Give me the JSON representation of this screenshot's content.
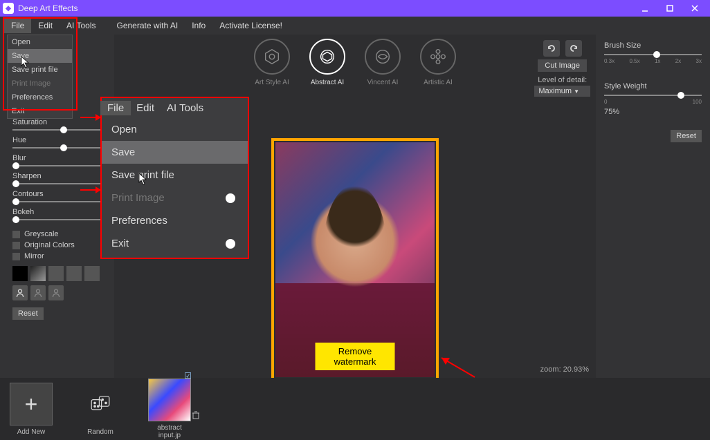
{
  "app": {
    "title": "Deep Art Effects"
  },
  "menu": {
    "file": "File",
    "edit": "Edit",
    "ai_tools": "AI Tools",
    "generate": "Generate with AI",
    "info": "Info",
    "activate": "Activate License!"
  },
  "file_menu": {
    "open": "Open",
    "save": "Save",
    "save_print": "Save print file",
    "print": "Print Image",
    "prefs": "Preferences",
    "exit": "Exit"
  },
  "sliders": {
    "saturation": "Saturation",
    "hue": "Hue",
    "blur": "Blur",
    "sharpen": "Sharpen",
    "contours": "Contours",
    "bokeh": "Bokeh"
  },
  "checks": {
    "grey": "Greyscale",
    "orig": "Original Colors",
    "mirror": "Mirror"
  },
  "reset": "Reset",
  "ai": {
    "art": "Art Style AI",
    "abstract": "Abstract AI",
    "vincent": "Vincent AI",
    "artistic": "Artistic AI"
  },
  "cut": {
    "button": "Cut Image",
    "lod_label": "Level of detail:",
    "lod_value": "Maximum"
  },
  "preview": {
    "remove_wm": "Remove watermark",
    "zoom": "zoom: 20.93%"
  },
  "right": {
    "brush_label": "Brush Size",
    "brush_marks": [
      "0.3x",
      "0.5x",
      "1x",
      "2x",
      "3x"
    ],
    "style_label": "Style Weight",
    "style_marks": [
      "0",
      "100"
    ],
    "style_value": "75%",
    "reset": "Reset"
  },
  "bottom": {
    "add": "Add New",
    "random": "Random",
    "file": "abstract input.jp"
  }
}
